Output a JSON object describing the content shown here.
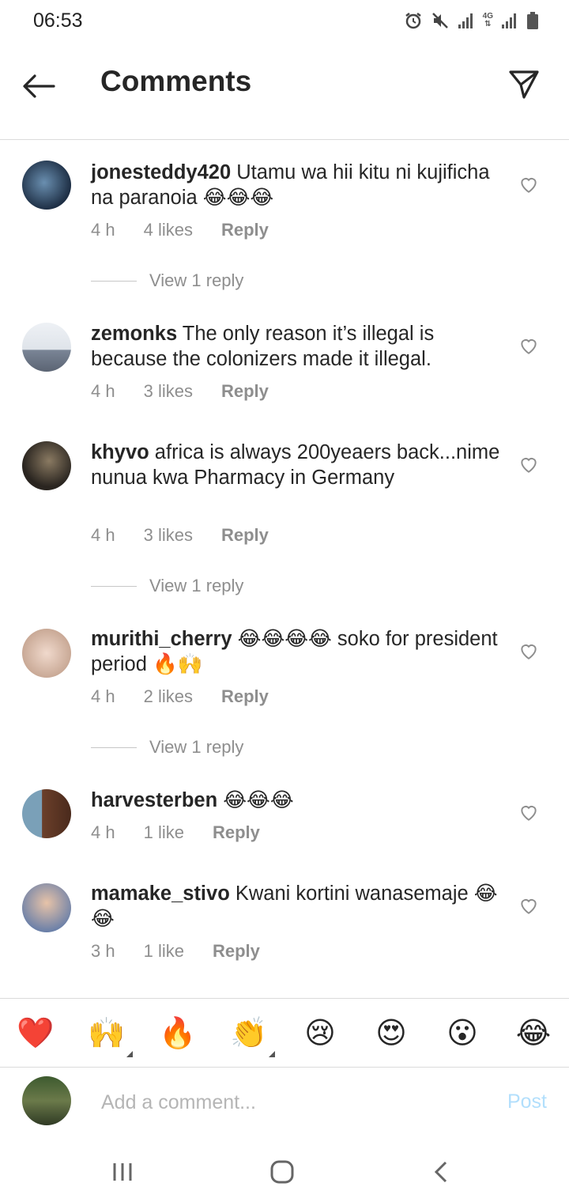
{
  "status_bar": {
    "time": "06:53",
    "network": "4G",
    "icons": [
      "alarm-icon",
      "mute-icon",
      "signal-icon",
      "4g-icon",
      "signal-icon",
      "battery-icon"
    ]
  },
  "header": {
    "title": "Comments",
    "back_icon": "arrow-left-icon",
    "send_icon": "paper-plane-icon"
  },
  "comments": [
    {
      "username": "jonesteddy420",
      "text": "Utamu wa hii kitu ni kujificha na paranoia 😂😂😂",
      "time": "4 h",
      "likes": "4 likes",
      "reply_label": "Reply",
      "view_replies": "View 1 reply"
    },
    {
      "username": "zemonks",
      "text": "The only reason it’s illegal is because the colonizers made it illegal.",
      "time": "4 h",
      "likes": "3 likes",
      "reply_label": "Reply"
    },
    {
      "username": "khyvo",
      "text": "africa is always 200yeaers back...nime nunua kwa Pharmacy in Germany",
      "time": "4 h",
      "likes": "3 likes",
      "reply_label": "Reply",
      "view_replies": "View 1 reply"
    },
    {
      "username": "murithi_cherry",
      "text": "😂😂😂😂 soko for president period 🔥🙌",
      "time": "4 h",
      "likes": "2 likes",
      "reply_label": "Reply",
      "view_replies": "View 1 reply"
    },
    {
      "username": "harvesterben",
      "text": "😂😂😂",
      "time": "4 h",
      "likes": "1 like",
      "reply_label": "Reply"
    },
    {
      "username": "mamake_stivo",
      "text": "Kwani kortini wanasemaje 😂😂",
      "time": "3 h",
      "likes": "1 like",
      "reply_label": "Reply"
    }
  ],
  "reactions": [
    "❤️",
    "🙌",
    "🔥",
    "👏",
    "😢",
    "😍",
    "😮",
    "😂"
  ],
  "composer": {
    "placeholder": "Add a comment...",
    "post_label": "Post"
  },
  "colors": {
    "text": "#262626",
    "secondary": "#8e8e8e",
    "post_disabled": "#b2dffc",
    "divider": "#dbdbdb"
  }
}
